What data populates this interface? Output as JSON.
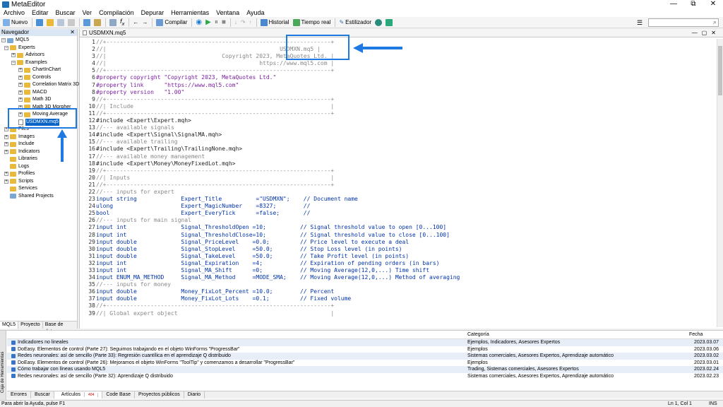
{
  "window": {
    "title": "MetaEditor",
    "min": "—",
    "max": "⧉",
    "close": "✕"
  },
  "menu": [
    "Archivo",
    "Editar",
    "Buscar",
    "Ver",
    "Compilación",
    "Depurar",
    "Herramientas",
    "Ventana",
    "Ayuda"
  ],
  "toolbar": {
    "new": "Nuevo",
    "compile": "Compilar",
    "history": "Historial",
    "realtime": "Tiempo real",
    "styler": "Estilizador"
  },
  "navigator": {
    "title": "Navegador",
    "close": "✕",
    "items": [
      {
        "label": "MQL5",
        "icon": "folder-icon"
      },
      {
        "label": "Experts",
        "icon": "folder-icon"
      },
      {
        "label": "Advisors",
        "icon": "folder-icon"
      },
      {
        "label": "Examples",
        "icon": "folder-icon"
      },
      {
        "label": "ChartInChart",
        "icon": "folder-icon"
      },
      {
        "label": "Controls",
        "icon": "folder-icon"
      },
      {
        "label": "Correlation Matrix 3D",
        "icon": "folder-icon"
      },
      {
        "label": "MACD",
        "icon": "folder-icon"
      },
      {
        "label": "Math 3D",
        "icon": "folder-icon"
      },
      {
        "label": "Math 3D Morpher",
        "icon": "folder-icon"
      },
      {
        "label": "Moving Average",
        "icon": "folder-icon"
      },
      {
        "label": "USDMXN.mq5",
        "icon": "file-icon"
      },
      {
        "label": "Files",
        "icon": "folder-icon"
      },
      {
        "label": "Images",
        "icon": "folder-icon"
      },
      {
        "label": "Include",
        "icon": "folder-icon"
      },
      {
        "label": "Indicators",
        "icon": "folder-icon"
      },
      {
        "label": "Libraries",
        "icon": "folder-icon"
      },
      {
        "label": "Logs",
        "icon": "folder-icon"
      },
      {
        "label": "Profiles",
        "icon": "folder-icon"
      },
      {
        "label": "Scripts",
        "icon": "folder-icon"
      },
      {
        "label": "Services",
        "icon": "folder-icon"
      },
      {
        "label": "Shared Projects",
        "icon": "folder-icon"
      }
    ],
    "tabs": [
      "MQL5",
      "Proyecto",
      "Base de datos"
    ]
  },
  "editor": {
    "tab": "USDMXN.mq5",
    "lines": [
      {
        "n": "1",
        "t": "//+------------------------------------------------------------------+",
        "c": "cm"
      },
      {
        "n": "2",
        "t": "//|                                                   USDMXN.mq5 |",
        "c": "cm"
      },
      {
        "n": "3",
        "t": "//|                                  Copyright 2023, MetaQuotes Ltd. |",
        "c": "cm"
      },
      {
        "n": "4",
        "t": "//|                                             https://www.mql5.com |",
        "c": "cm"
      },
      {
        "n": "5",
        "t": "//+------------------------------------------------------------------+",
        "c": "cm"
      },
      {
        "n": "6",
        "t": "#property copyright \"Copyright 2023, MetaQuotes Ltd.\"",
        "c": "prop"
      },
      {
        "n": "7",
        "t": "#property link      \"https://www.mql5.com\"",
        "c": "prop"
      },
      {
        "n": "8",
        "t": "#property version   \"1.00\"",
        "c": "prop"
      },
      {
        "n": "9",
        "t": "//+------------------------------------------------------------------+",
        "c": "cm"
      },
      {
        "n": "10",
        "t": "//| Include                                                          |",
        "c": "cm"
      },
      {
        "n": "11",
        "t": "//+------------------------------------------------------------------+",
        "c": "cm"
      },
      {
        "n": "12",
        "t": "#include <Expert\\Expert.mqh>",
        "c": "inc"
      },
      {
        "n": "13",
        "t": "//--- available signals",
        "c": "cm"
      },
      {
        "n": "14",
        "t": "#include <Expert\\Signal\\SignalMA.mqh>",
        "c": "inc"
      },
      {
        "n": "15",
        "t": "//--- available trailing",
        "c": "cm"
      },
      {
        "n": "16",
        "t": "#include <Expert\\Trailing\\TrailingNone.mqh>",
        "c": "inc"
      },
      {
        "n": "17",
        "t": "//--- available money management",
        "c": "cm"
      },
      {
        "n": "18",
        "t": "#include <Expert\\Money\\MoneyFixedLot.mqh>",
        "c": "inc"
      },
      {
        "n": "19",
        "t": "//+------------------------------------------------------------------+",
        "c": "cm"
      },
      {
        "n": "20",
        "t": "//| Inputs                                                           |",
        "c": "cm"
      },
      {
        "n": "21",
        "t": "//+------------------------------------------------------------------+",
        "c": "cm"
      },
      {
        "n": "22",
        "t": "//--- inputs for expert",
        "c": "cm"
      },
      {
        "n": "23",
        "t": "input string             Expert_Title          =\"USDMXN\";    // Document name",
        "c": "input"
      },
      {
        "n": "24",
        "t": "ulong                    Expert_MagicNumber    =8327;        //",
        "c": "input"
      },
      {
        "n": "25",
        "t": "bool                     Expert_EveryTick      =false;       //",
        "c": "input"
      },
      {
        "n": "26",
        "t": "//--- inputs for main signal",
        "c": "cm"
      },
      {
        "n": "27",
        "t": "input int                Signal_ThresholdOpen =10;          // Signal threshold value to open [0...100]",
        "c": "input"
      },
      {
        "n": "28",
        "t": "input int                Signal_ThresholdClose=10;          // Signal threshold value to close [0...100]",
        "c": "input"
      },
      {
        "n": "29",
        "t": "input double             Signal_PriceLevel    =0.0;         // Price level to execute a deal",
        "c": "input"
      },
      {
        "n": "30",
        "t": "input double             Signal_StopLevel     =50.0;        // Stop Loss level (in points)",
        "c": "input"
      },
      {
        "n": "31",
        "t": "input double             Signal_TakeLevel     =50.0;        // Take Profit level (in points)",
        "c": "input"
      },
      {
        "n": "32",
        "t": "input int                Signal_Expiration    =4;           // Expiration of pending orders (in bars)",
        "c": "input"
      },
      {
        "n": "33",
        "t": "input int                Signal_MA_Shift      =0;           // Moving Average(12,0,...) Time shift",
        "c": "input"
      },
      {
        "n": "34",
        "t": "input ENUM_MA_METHOD     Signal_MA_Method     =MODE_SMA;    // Moving Average(12,0,...) Method of averaging",
        "c": "input"
      },
      {
        "n": "35",
        "t": "//--- inputs for money",
        "c": "cm"
      },
      {
        "n": "36",
        "t": "input double             Money_FixLot_Percent =10.0;        // Percent",
        "c": "input"
      },
      {
        "n": "37",
        "t": "input double             Money_FixLot_Lots    =0.1;         // Fixed volume",
        "c": "input"
      },
      {
        "n": "38",
        "t": "//+------------------------------------------------------------------+",
        "c": "cm"
      },
      {
        "n": "39",
        "t": "//| Global expert object                                             |",
        "c": "cm"
      }
    ]
  },
  "toolbox": {
    "side_label": "Caja de Herramientas",
    "headers": {
      "name": "",
      "category": "Categoría",
      "date": "Fecha"
    },
    "rows": [
      {
        "name": "Indicadores no lineales",
        "category": "Ejemplos, Indicadores, Asesores Expertos",
        "date": "2023.03.07"
      },
      {
        "name": "DoEasy. Elementos de control (Parte 27): Seguimos trabajando en el objeto WinForms \"ProgressBar\"",
        "category": "Ejemplos",
        "date": "2023.03.06"
      },
      {
        "name": "Redes neuronales: así de sencillo (Parte 33): Regresión cuantílica en el aprendizaje Q distribuido",
        "category": "Sistemas comerciales, Asesores Expertos, Aprendizaje automático",
        "date": "2023.03.02"
      },
      {
        "name": "DoEasy. Elementos de control (Parte 26): Mejoramos el objeto WinForms \"ToolTip\" y comenzamos a desarrollar \"ProgressBar\"",
        "category": "Ejemplos",
        "date": "2023.03.01"
      },
      {
        "name": "Cómo trabajar con líneas usando MQL5",
        "category": "Trading, Sistemas comerciales, Asesores Expertos",
        "date": "2023.02.24"
      },
      {
        "name": "Redes neuronales: así de sencillo (Parte 32): Aprendizaje Q distribuido",
        "category": "Sistemas comerciales, Asesores Expertos, Aprendizaje automático",
        "date": "2023.02.23"
      }
    ],
    "tabs": [
      {
        "label": "Errores"
      },
      {
        "label": "Buscar"
      },
      {
        "label": "Artículos",
        "badge": "404"
      },
      {
        "label": "Code Base"
      },
      {
        "label": "Proyectos públicos"
      },
      {
        "label": "Diario"
      }
    ]
  },
  "status": {
    "help": "Para abrir la Ayuda, pulse F1",
    "pos": "Ln 1, Col 1",
    "mode": "INS"
  },
  "colors": {
    "highlight": "#1e7ae0",
    "selection": "#0a64c8"
  }
}
